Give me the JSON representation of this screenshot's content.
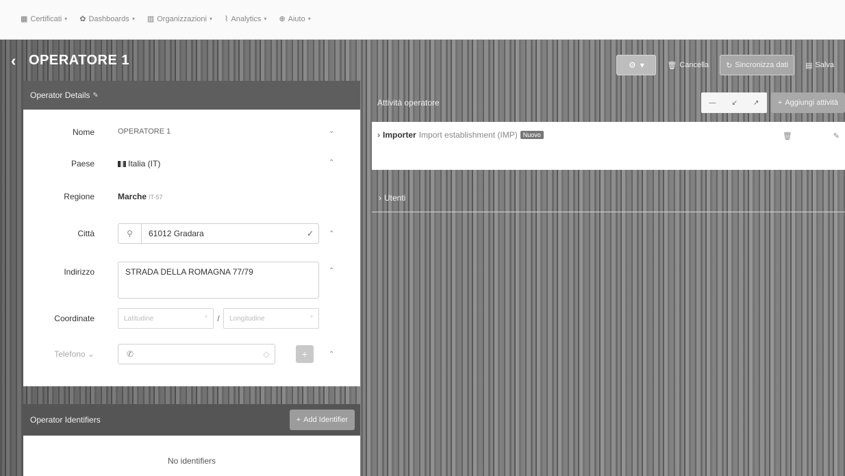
{
  "menu": [
    {
      "icon": "certificate-icon",
      "glyph": "▦",
      "label": "Certificati"
    },
    {
      "icon": "dashboard-icon",
      "glyph": "✿",
      "label": "Dashboards"
    },
    {
      "icon": "organization-icon",
      "glyph": "▥",
      "label": "Organizzazioni"
    },
    {
      "icon": "analytics-icon",
      "glyph": "⌇",
      "label": "Analytics"
    },
    {
      "icon": "help-icon",
      "glyph": "⊕",
      "label": "Aiuto"
    }
  ],
  "header": {
    "title": "OPERATORE 1",
    "gear_glyph": "⚙",
    "cancel_label": "Cancella",
    "sync_label": "Sincronizza dati",
    "save_label": "Salva"
  },
  "operator_details": {
    "title": "Operator Details",
    "name_label": "Nome",
    "name_value": "OPERATORE 1",
    "country_label": "Paese",
    "country_value": "Italia (IT)",
    "region_label": "Regione",
    "region_value": "Marche",
    "region_code": "IT-57",
    "city_label": "Città",
    "city_value": "61012 Gradara",
    "address_label": "Indirizzo",
    "address_value": "STRADA DELLA ROMAGNA 77/79",
    "coords_label": "Coordinate",
    "lat_placeholder": "Latitudine",
    "lng_placeholder": "Longitudine",
    "phone_label": "Telefono"
  },
  "identifiers": {
    "title": "Operator Identifiers",
    "add_label": "Add Identifier",
    "empty_text": "No identifiers"
  },
  "activities": {
    "title": "Attività operatore",
    "add_label": "Aggiungi attività",
    "item_label": "Importer",
    "item_detail": "Import establishment (IMP)",
    "item_tag": "Nuovo"
  },
  "users": {
    "title": "Utenti"
  }
}
